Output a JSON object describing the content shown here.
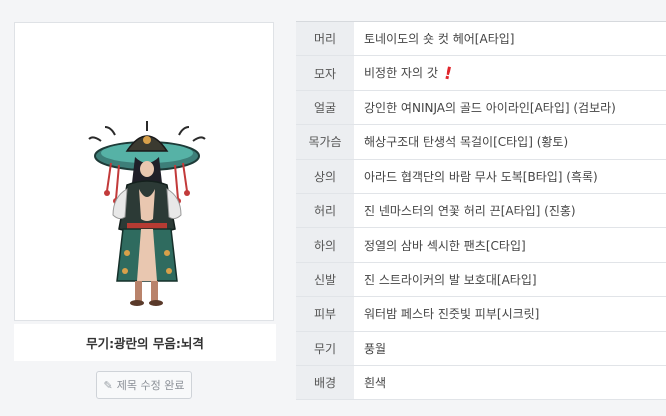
{
  "character": {
    "caption": "무기:광란의 무음:뇌격",
    "edit_button_label": "제목 수정 완료",
    "image_icon": "character-sprite"
  },
  "equipment": [
    {
      "slot": "머리",
      "item": "토네이도의 숏 컷 헤어[A타입]",
      "warn": false
    },
    {
      "slot": "모자",
      "item": "비정한 자의 갓",
      "warn": true
    },
    {
      "slot": "얼굴",
      "item": "강인한 여NINJA의 골드 아이라인[A타입] (검보라)",
      "warn": false
    },
    {
      "slot": "목가슴",
      "item": "해상구조대 탄생석 목걸이[C타입] (황토)",
      "warn": false
    },
    {
      "slot": "상의",
      "item": "아라드 협객단의 바람 무사 도복[B타입] (흑록)",
      "warn": false
    },
    {
      "slot": "허리",
      "item": "진 넨마스터의 연꽃 허리 끈[A타입] (진홍)",
      "warn": false
    },
    {
      "slot": "하의",
      "item": "정열의 삼바 섹시한 팬츠[C타입]",
      "warn": false
    },
    {
      "slot": "신발",
      "item": "진 스트라이커의 발 보호대[A타입]",
      "warn": false
    },
    {
      "slot": "피부",
      "item": "워터밤 페스타 진줏빛 피부[시크릿]",
      "warn": false
    },
    {
      "slot": "무기",
      "item": "풍월",
      "warn": false
    },
    {
      "slot": "배경",
      "item": "흰색",
      "warn": false
    }
  ],
  "colors": {
    "warn": "#e0262c",
    "slot_bg": "#eceef1",
    "page_bg": "#f4f5f7"
  }
}
